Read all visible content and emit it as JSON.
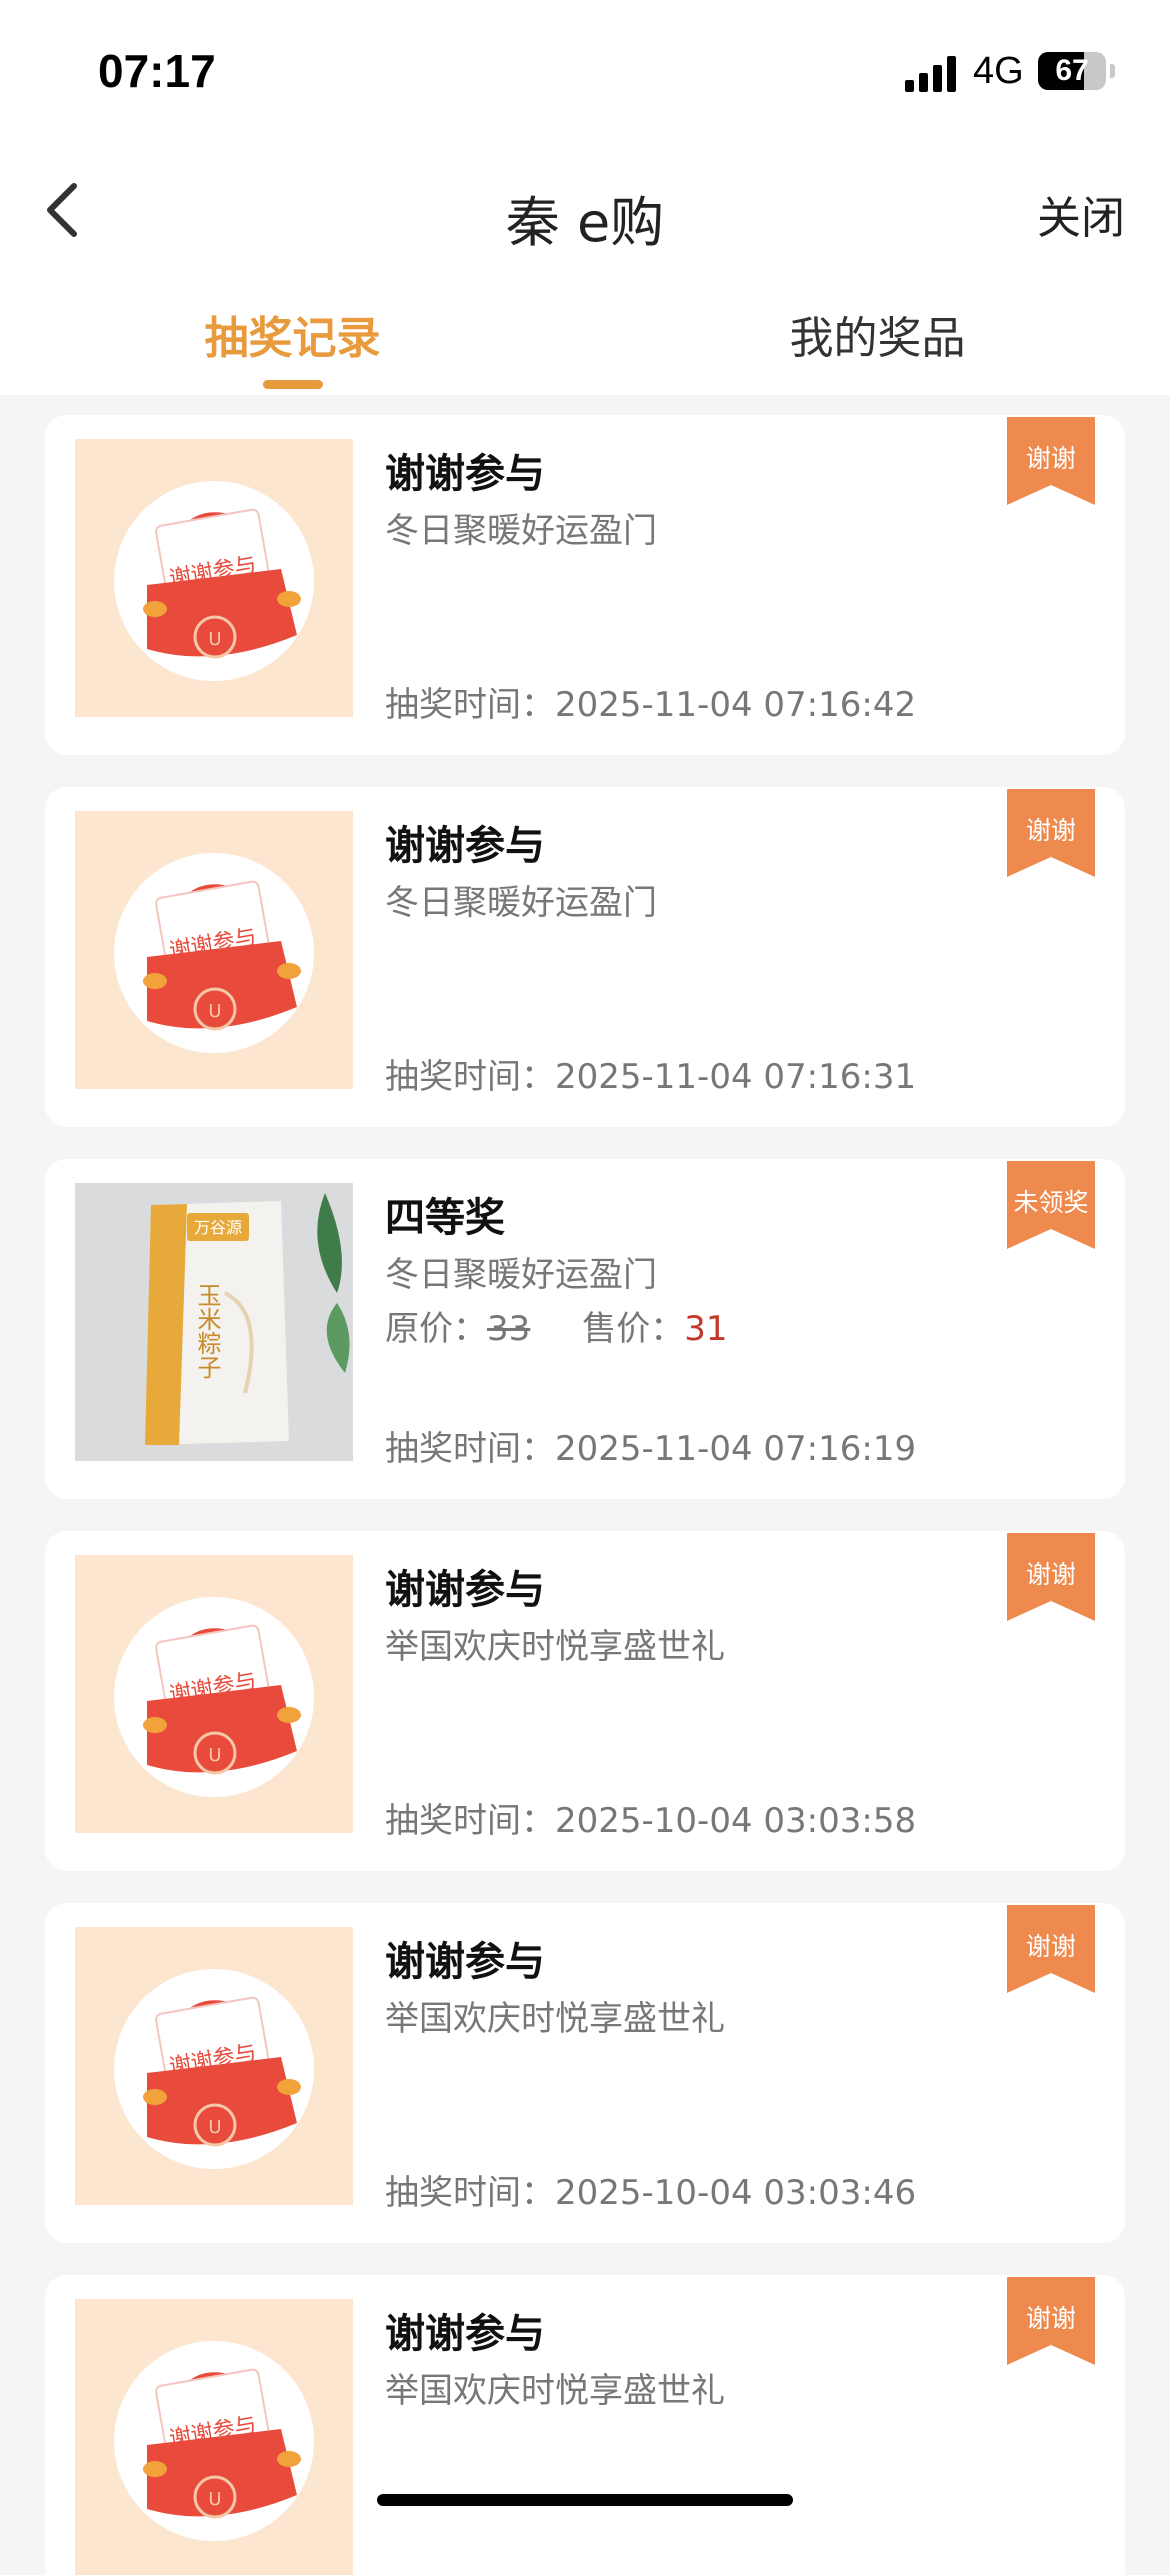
{
  "status_bar": {
    "time": "07:17",
    "network": "4G",
    "battery": "67",
    "battery_level": 0.67
  },
  "nav": {
    "title": "秦 e购",
    "close_label": "关闭"
  },
  "tabs": [
    {
      "label": "抽奖记录",
      "active": true
    },
    {
      "label": "我的奖品",
      "active": false
    }
  ],
  "records": [
    {
      "name": "谢谢参与",
      "activity": "冬日聚暖好运盈门",
      "time": "抽奖时间：2025-11-04 07:16:42",
      "badge": "谢谢",
      "thumb": "thanks-envelope"
    },
    {
      "name": "谢谢参与",
      "activity": "冬日聚暖好运盈门",
      "time": "抽奖时间：2025-11-04 07:16:31",
      "badge": "谢谢",
      "thumb": "thanks-envelope"
    },
    {
      "name": "四等奖",
      "activity": "冬日聚暖好运盈门",
      "price_label": "原价：",
      "original_price": "33",
      "sale_label": "售价：",
      "sale_price": "31",
      "time": "抽奖时间：2025-11-04 07:16:19",
      "badge": "未领奖",
      "thumb": "corn-bag",
      "product_brand": "万谷源",
      "product_text": "玉米粽子"
    },
    {
      "name": "谢谢参与",
      "activity": "举国欢庆时悦享盛世礼",
      "time": "抽奖时间：2025-10-04 03:03:58",
      "badge": "谢谢",
      "thumb": "thanks-envelope"
    },
    {
      "name": "谢谢参与",
      "activity": "举国欢庆时悦享盛世礼",
      "time": "抽奖时间：2025-10-04 03:03:46",
      "badge": "谢谢",
      "thumb": "thanks-envelope"
    },
    {
      "name": "谢谢参与",
      "activity": "举国欢庆时悦享盛世礼",
      "time": "",
      "badge": "谢谢",
      "thumb": "thanks-envelope"
    }
  ],
  "thumb_text": "谢谢参与",
  "colors": {
    "accent": "#e89a3c",
    "badge": "#ef8a4f",
    "sale_price": "#c0392b",
    "envelope_red": "#e84a3c",
    "thumb_bg": "#fce6cf"
  }
}
